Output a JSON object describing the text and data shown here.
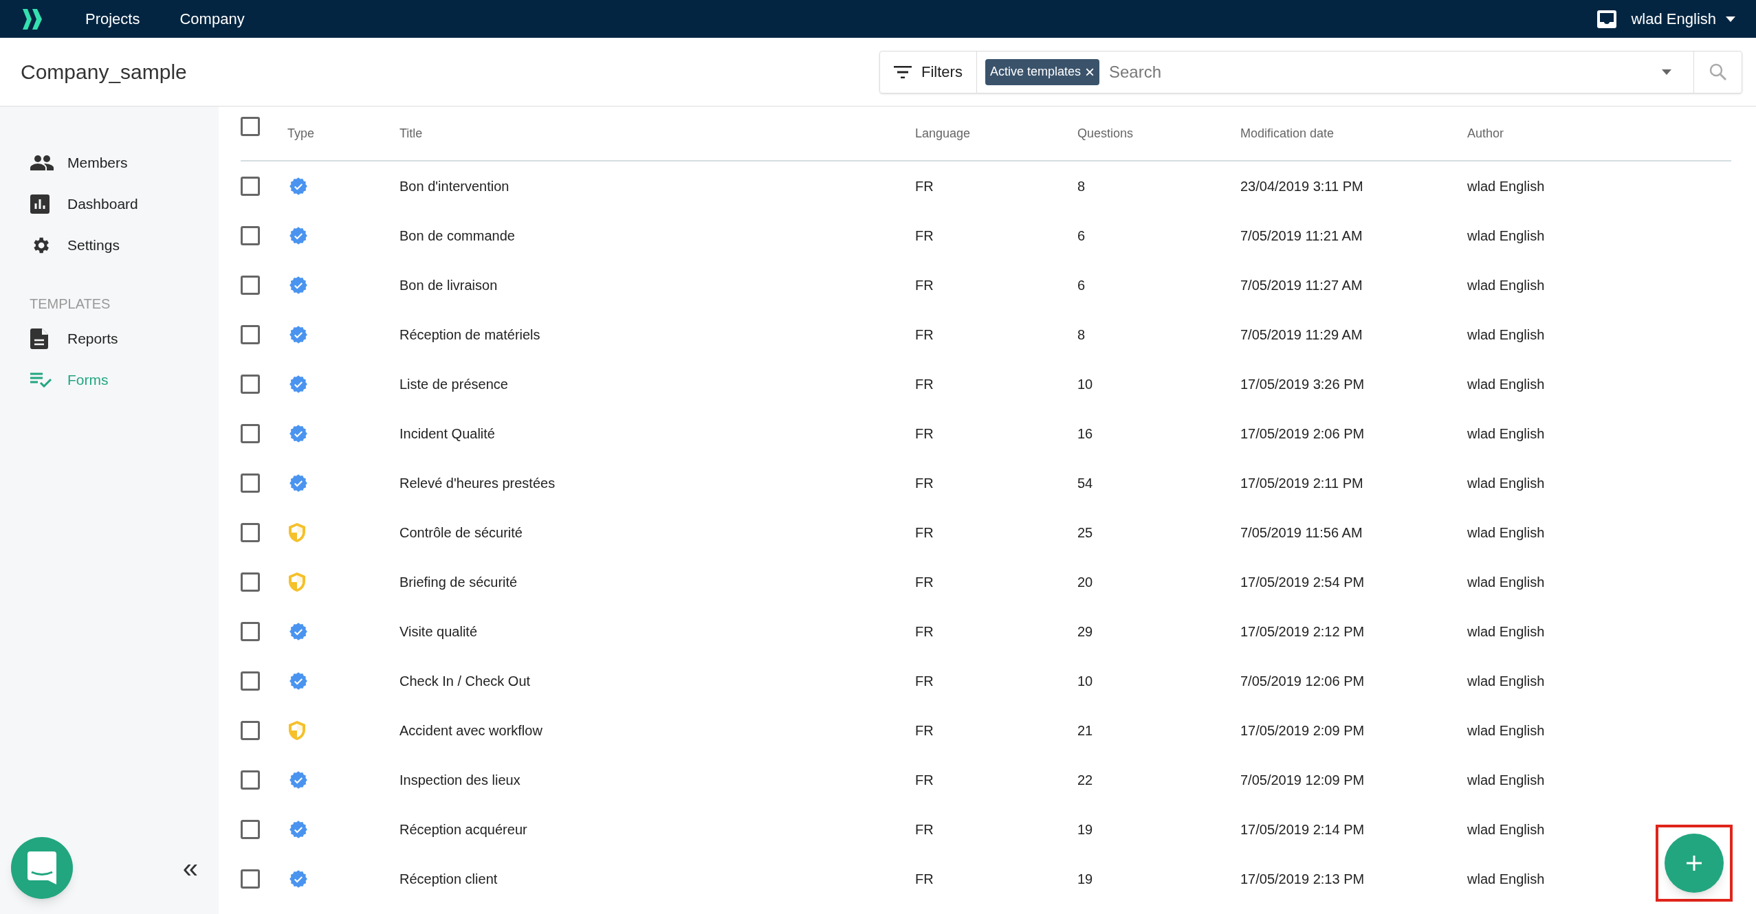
{
  "top_nav": {
    "links": [
      "Projects",
      "Company"
    ],
    "user": "wlad English"
  },
  "header": {
    "title": "Company_sample",
    "filters_label": "Filters",
    "active_filter": "Active templates",
    "remove_filter": "×",
    "search": {
      "placeholder": "Search"
    }
  },
  "sidebar": {
    "items": [
      {
        "label": "Members",
        "selected": false
      },
      {
        "label": "Dashboard",
        "selected": false
      },
      {
        "label": "Settings",
        "selected": false
      }
    ],
    "section": "TEMPLATES",
    "template_items": [
      {
        "label": "Reports",
        "selected": false
      },
      {
        "label": "Forms",
        "selected": true
      }
    ],
    "collapse": "«"
  },
  "table": {
    "columns": [
      "Type",
      "Title",
      "Language",
      "Questions",
      "Modification date",
      "Author"
    ],
    "all_checked": false,
    "rows": [
      {
        "checked": false,
        "kind": "verified",
        "title": "Bon d'intervention",
        "language": "FR",
        "questions": "8",
        "date": "23/04/2019 3:11 PM",
        "author": "wlad English"
      },
      {
        "checked": false,
        "kind": "verified",
        "title": "Bon de commande",
        "language": "FR",
        "questions": "6",
        "date": "7/05/2019 11:21 AM",
        "author": "wlad English"
      },
      {
        "checked": false,
        "kind": "verified",
        "title": "Bon de livraison",
        "language": "FR",
        "questions": "6",
        "date": "7/05/2019 11:27 AM",
        "author": "wlad English"
      },
      {
        "checked": false,
        "kind": "verified",
        "title": "Réception de matériels",
        "language": "FR",
        "questions": "8",
        "date": "7/05/2019 11:29 AM",
        "author": "wlad English"
      },
      {
        "checked": false,
        "kind": "verified",
        "title": "Liste de présence",
        "language": "FR",
        "questions": "10",
        "date": "17/05/2019 3:26 PM",
        "author": "wlad English"
      },
      {
        "checked": false,
        "kind": "verified",
        "title": "Incident Qualité",
        "language": "FR",
        "questions": "16",
        "date": "17/05/2019 2:06 PM",
        "author": "wlad English"
      },
      {
        "checked": false,
        "kind": "verified",
        "title": "Relevé d'heures prestées",
        "language": "FR",
        "questions": "54",
        "date": "17/05/2019 2:11 PM",
        "author": "wlad English"
      },
      {
        "checked": false,
        "kind": "shield",
        "title": "Contrôle de sécurité",
        "language": "FR",
        "questions": "25",
        "date": "7/05/2019 11:56 AM",
        "author": "wlad English"
      },
      {
        "checked": false,
        "kind": "shield",
        "title": "Briefing de sécurité",
        "language": "FR",
        "questions": "20",
        "date": "17/05/2019 2:54 PM",
        "author": "wlad English"
      },
      {
        "checked": false,
        "kind": "verified",
        "title": "Visite qualité",
        "language": "FR",
        "questions": "29",
        "date": "17/05/2019 2:12 PM",
        "author": "wlad English"
      },
      {
        "checked": false,
        "kind": "verified",
        "title": "Check In / Check Out",
        "language": "FR",
        "questions": "10",
        "date": "7/05/2019 12:06 PM",
        "author": "wlad English"
      },
      {
        "checked": false,
        "kind": "shield",
        "title": "Accident avec workflow",
        "language": "FR",
        "questions": "21",
        "date": "17/05/2019 2:09 PM",
        "author": "wlad English"
      },
      {
        "checked": false,
        "kind": "verified",
        "title": "Inspection des lieux",
        "language": "FR",
        "questions": "22",
        "date": "7/05/2019 12:09 PM",
        "author": "wlad English"
      },
      {
        "checked": false,
        "kind": "verified",
        "title": "Réception acquéreur",
        "language": "FR",
        "questions": "19",
        "date": "17/05/2019 2:14 PM",
        "author": "wlad English"
      },
      {
        "checked": false,
        "kind": "verified",
        "title": "Réception client",
        "language": "FR",
        "questions": "19",
        "date": "17/05/2019 2:13 PM",
        "author": "wlad English"
      }
    ]
  },
  "fab": {
    "highlighted": true
  }
}
